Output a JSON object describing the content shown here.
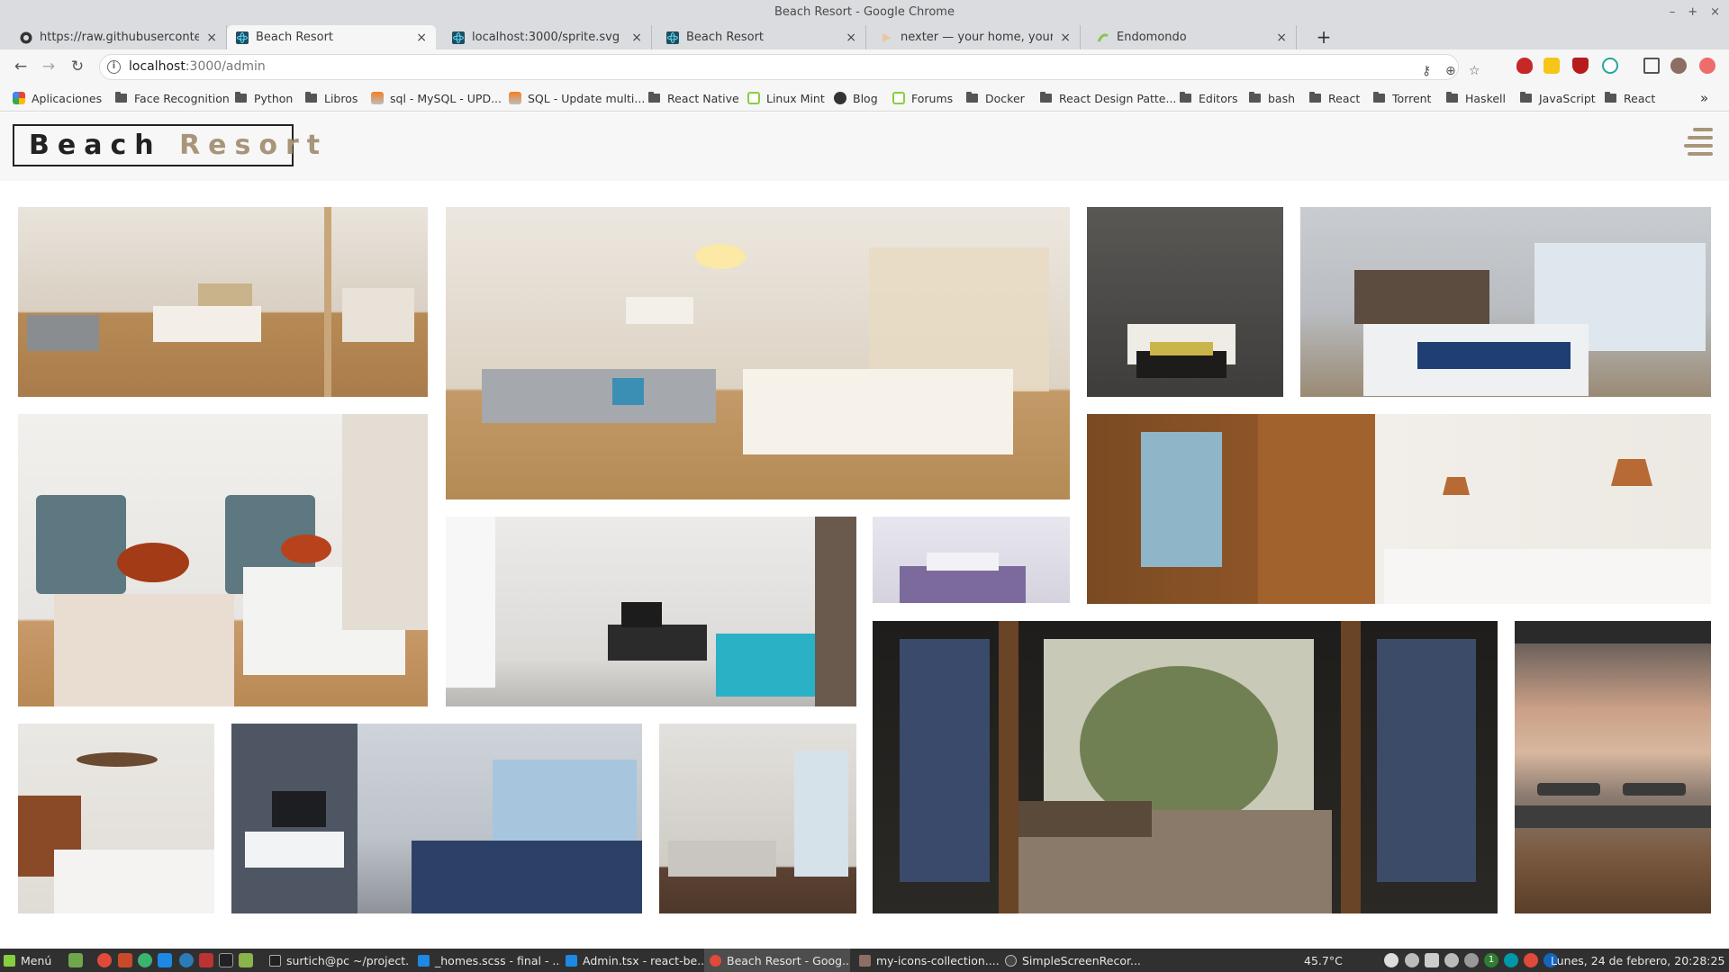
{
  "window": {
    "title": "Beach Resort - Google Chrome",
    "controls": [
      "–",
      "+",
      "×"
    ]
  },
  "tabs": [
    {
      "label": "https://raw.githubusercontent.c",
      "icon": "github-icon",
      "active": false
    },
    {
      "label": "Beach Resort",
      "icon": "react-icon",
      "active": true
    },
    {
      "label": "localhost:3000/sprite.svg",
      "icon": "react-icon",
      "active": false
    },
    {
      "label": "Beach Resort",
      "icon": "react-icon",
      "active": false
    },
    {
      "label": "nexter — your home, your free",
      "icon": "nexter-icon",
      "active": false
    },
    {
      "label": "Endomondo",
      "icon": "endomondo-icon",
      "active": false
    }
  ],
  "newtab_label": "+",
  "omnibox": {
    "host": "localhost",
    "path": ":3000/admin"
  },
  "bookmarks": [
    {
      "label": "Aplicaciones",
      "icon": "apps-icon"
    },
    {
      "label": "Face Recognition",
      "icon": "folder-icon"
    },
    {
      "label": "Python",
      "icon": "folder-icon"
    },
    {
      "label": "Libros",
      "icon": "folder-icon"
    },
    {
      "label": "sql - MySQL - UPD...",
      "icon": "stackoverflow-icon"
    },
    {
      "label": "SQL - Update multi...",
      "icon": "stackoverflow-icon"
    },
    {
      "label": "React Native",
      "icon": "folder-icon"
    },
    {
      "label": "Linux Mint",
      "icon": "linuxmint-icon"
    },
    {
      "label": "Blog",
      "icon": "globe-icon"
    },
    {
      "label": "Forums",
      "icon": "linuxmint-icon"
    },
    {
      "label": "Docker",
      "icon": "folder-icon"
    },
    {
      "label": "React Design Patte...",
      "icon": "folder-icon"
    },
    {
      "label": "Editors",
      "icon": "folder-icon"
    },
    {
      "label": "bash",
      "icon": "folder-icon"
    },
    {
      "label": "React",
      "icon": "folder-icon"
    },
    {
      "label": "Torrent",
      "icon": "folder-icon"
    },
    {
      "label": "Haskell",
      "icon": "folder-icon"
    },
    {
      "label": "JavaScript",
      "icon": "folder-icon"
    },
    {
      "label": "React",
      "icon": "folder-icon"
    }
  ],
  "bookmarks_more": "»",
  "page": {
    "logo_word1": "Beach",
    "logo_word2": "Resort",
    "accent_color": "#a8957a",
    "gallery_count": 15
  },
  "taskbar": {
    "menu_label": "Menú",
    "windows": [
      {
        "label": "surtich@pc ~/project...",
        "icon": "terminal-icon"
      },
      {
        "label": "_homes.scss - final - ...",
        "icon": "vscode-icon"
      },
      {
        "label": "Admin.tsx - react-be...",
        "icon": "vscode-icon"
      },
      {
        "label": "Beach Resort - Goog...",
        "icon": "chrome-icon",
        "active": true
      },
      {
        "label": "my-icons-collection....",
        "icon": "image-viewer-icon"
      },
      {
        "label": "SimpleScreenRecor...",
        "icon": "recorder-icon"
      }
    ],
    "temperature": "45.7°C",
    "clock": "Lunes, 24 de febrero, 20:28:25",
    "notif_count": "1"
  }
}
